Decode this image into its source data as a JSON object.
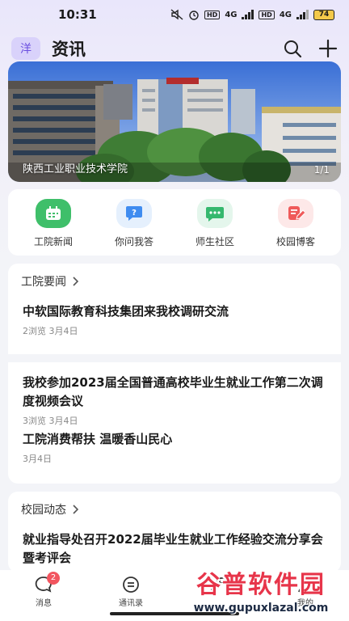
{
  "status_bar": {
    "time": "10:31",
    "battery": "74",
    "network_1": "4G",
    "network_2": "4G"
  },
  "header": {
    "avatar_text": "洋",
    "title": "资讯"
  },
  "banner": {
    "caption": "陕西工业职业技术学院",
    "index": "1/1"
  },
  "quick_links": [
    {
      "label": "工院新闻",
      "icon": "calendar-icon",
      "color": "#3fbf6a",
      "bg": "#e6f7ec"
    },
    {
      "label": "你问我答",
      "icon": "question-chat-icon",
      "color": "#3f8cf0",
      "bg": "#e5f0fd"
    },
    {
      "label": "师生社区",
      "icon": "chat-bubble-icon",
      "color": "#35b86e",
      "bg": "#e4f6ec"
    },
    {
      "label": "校园博客",
      "icon": "blog-edit-icon",
      "color": "#ef5a5a",
      "bg": "#fde8e8"
    }
  ],
  "section_news": {
    "title": "工院要闻",
    "items": [
      {
        "title": "中软国际教育科技集团来我校调研交流",
        "meta": "2浏览  3月4日"
      },
      {
        "title": "我校参加2023届全国普通高校毕业生就业工作第二次调度视频会议",
        "meta": "3浏览  3月4日"
      },
      {
        "title": "工院消费帮扶 温暖香山民心",
        "meta": "3月4日"
      }
    ]
  },
  "section_campus": {
    "title": "校园动态",
    "items": [
      {
        "title": "就业指导处召开2022届毕业生就业工作经验交流分享会暨考评会"
      }
    ]
  },
  "bottom_nav": {
    "items": [
      {
        "label": "消息",
        "badge": "2"
      },
      {
        "label": "通讯录"
      },
      {
        "label": ""
      },
      {
        "label": "我的"
      }
    ]
  },
  "watermark": {
    "big": "谷普软件园",
    "small": "www.gupuxlazal.com"
  },
  "colors": {
    "accent": "#6b4fe0",
    "badge": "#f2555f",
    "page_bg": "#f3f4f8"
  }
}
